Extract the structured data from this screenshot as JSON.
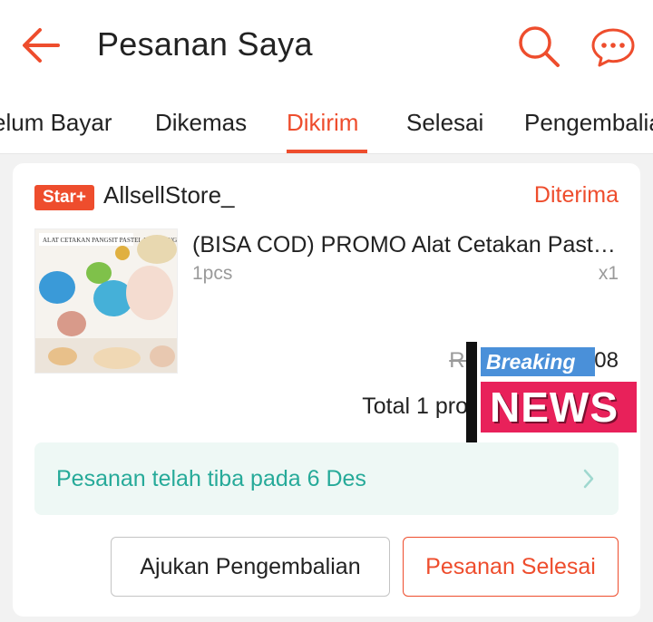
{
  "header": {
    "title": "Pesanan Saya",
    "back_icon": "back-arrow-icon",
    "search_icon": "search-icon",
    "chat_icon": "chat-icon"
  },
  "tabs": [
    {
      "label": "elum Bayar",
      "active": false
    },
    {
      "label": "Dikemas",
      "active": false
    },
    {
      "label": "Dikirim",
      "active": true
    },
    {
      "label": "Selesai",
      "active": false
    },
    {
      "label": "Pengembalian",
      "active": false
    }
  ],
  "order": {
    "badge": "Star+",
    "shop_name": "AllsellStore_",
    "status": "Diterima",
    "product": {
      "name": "(BISA COD) PROMO Alat Cetakan Pastel Dumpling",
      "variant": "1pcs",
      "quantity": "x1",
      "thumbnail_caption": "ALAT CETAKAN PANGSIT PASTEL DUMPLING",
      "original_price_prefix": "Rp",
      "price_suffix": "08"
    },
    "total_label": "Total 1 pro",
    "arrival_message": "Pesanan telah tiba pada 6 Des",
    "buttons": {
      "return_label": "Ajukan Pengembalian",
      "complete_label": "Pesanan Selesai"
    }
  },
  "overlay": {
    "breaking": "Breaking",
    "news": "NEWS"
  },
  "colors": {
    "accent": "#ee4d2d",
    "teal": "#26aa99",
    "arrival_bg": "#eef8f5"
  }
}
